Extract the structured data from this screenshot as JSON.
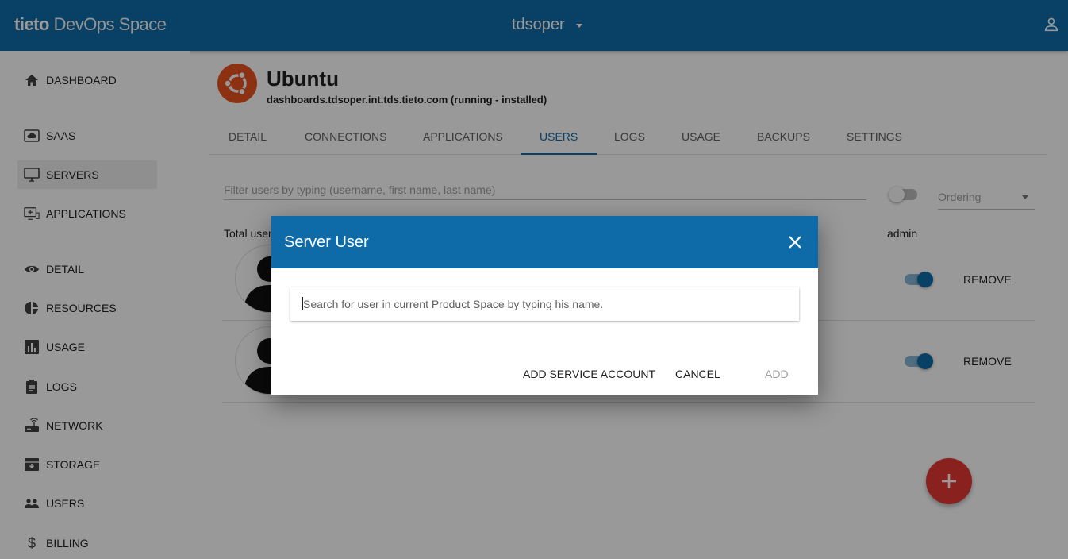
{
  "header": {
    "brand_bold": "tieto",
    "brand_light": " DevOps Space",
    "space_name": "tdsoper"
  },
  "sidebar": {
    "items": [
      {
        "label": "DASHBOARD",
        "icon": "home-icon"
      },
      {
        "label": "SAAS",
        "icon": "cloud-icon"
      },
      {
        "label": "SERVERS",
        "icon": "monitor-icon",
        "active": true
      },
      {
        "label": "APPLICATIONS",
        "icon": "applications-icon"
      },
      {
        "label": "DETAIL",
        "icon": "eye-icon"
      },
      {
        "label": "RESOURCES",
        "icon": "pie-chart-icon"
      },
      {
        "label": "USAGE",
        "icon": "bar-chart-icon"
      },
      {
        "label": "LOGS",
        "icon": "clipboard-icon"
      },
      {
        "label": "NETWORK",
        "icon": "router-icon"
      },
      {
        "label": "STORAGE",
        "icon": "archive-icon"
      },
      {
        "label": "USERS",
        "icon": "users-icon"
      },
      {
        "label": "BILLING",
        "icon": "dollar-icon"
      }
    ]
  },
  "app": {
    "name": "Ubuntu",
    "subtitle": "dashboards.tdsoper.int.tds.tieto.com (running - installed)"
  },
  "tabs": [
    "DETAIL",
    "CONNECTIONS",
    "APPLICATIONS",
    "USERS",
    "LOGS",
    "USAGE",
    "BACKUPS",
    "SETTINGS"
  ],
  "active_tab": "USERS",
  "users_panel": {
    "filter_placeholder": "Filter users by typing (username, first name, last name)",
    "ordering_label": "Ordering",
    "total_users_label": "Total user",
    "admin_header": "admin",
    "remove_label": "REMOVE",
    "rows": [
      {
        "admin": true
      },
      {
        "admin": true
      }
    ]
  },
  "dialog": {
    "title": "Server User",
    "search_placeholder": "Search for user in current Product Space by typing his name.",
    "add_service_account_label": "ADD SERVICE ACCOUNT",
    "cancel_label": "CANCEL",
    "add_label": "ADD"
  },
  "colors": {
    "primary": "#0f6ba8",
    "fab": "#e53935",
    "ubuntu": "#e95420"
  }
}
